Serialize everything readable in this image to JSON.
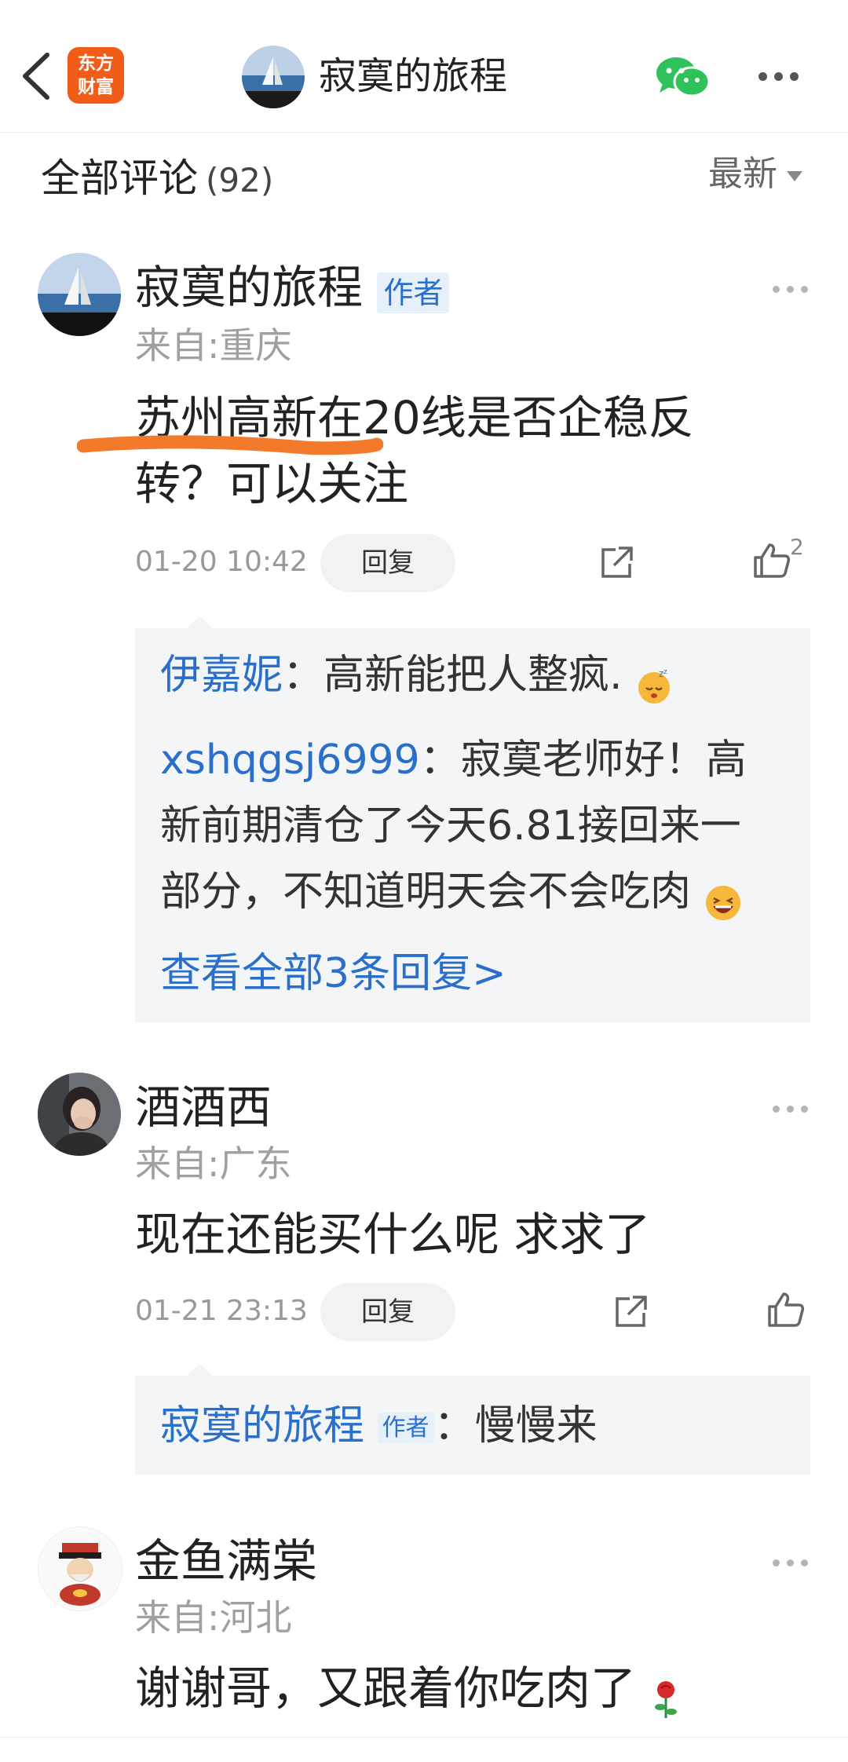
{
  "header": {
    "logo_line1": "东方",
    "logo_line2": "财富",
    "title": "寂寞的旅程"
  },
  "section": {
    "title": "全部评论",
    "count": "(92)",
    "sort_label": "最新"
  },
  "comments": [
    {
      "name": "寂寞的旅程",
      "badge": "作者",
      "from": "来自:重庆",
      "text_line1": "苏州高新在20线是否企稳反",
      "text_line2": "转？可以关注",
      "time": "01-20 10:42",
      "reply_label": "回复",
      "likes": "2",
      "replies": [
        {
          "name": "伊嘉妮",
          "sep": "：",
          "text": "高新能把人整疯."
        },
        {
          "name": "xshqgsj6999",
          "sep": "：",
          "text_line1": "寂寞老师好！高",
          "text_line2": "新前期清仓了今天6.81接回来一",
          "text_line3": "部分，不知道明天会不会吃肉"
        }
      ],
      "view_all": "查看全部3条回复>"
    },
    {
      "name": "酒酒西",
      "from": "来自:广东",
      "text": "现在还能买什么呢 求求了",
      "time": "01-21 23:13",
      "reply_label": "回复",
      "replies": [
        {
          "name": "寂寞的旅程",
          "badge": "作者",
          "sep": "：",
          "text": "慢慢来"
        }
      ]
    },
    {
      "name": "金鱼满棠",
      "from": "来自:河北",
      "text": "谢谢哥，又跟着你吃肉了"
    }
  ],
  "icons": {
    "back": "chevron-left-icon",
    "wechat": "wechat-icon",
    "more": "more-icon",
    "share": "share-icon",
    "like": "thumbs-up-icon"
  },
  "colors": {
    "accent": "#2a6fca",
    "logo": "#f25c19",
    "highlight": "#f47a2b"
  }
}
